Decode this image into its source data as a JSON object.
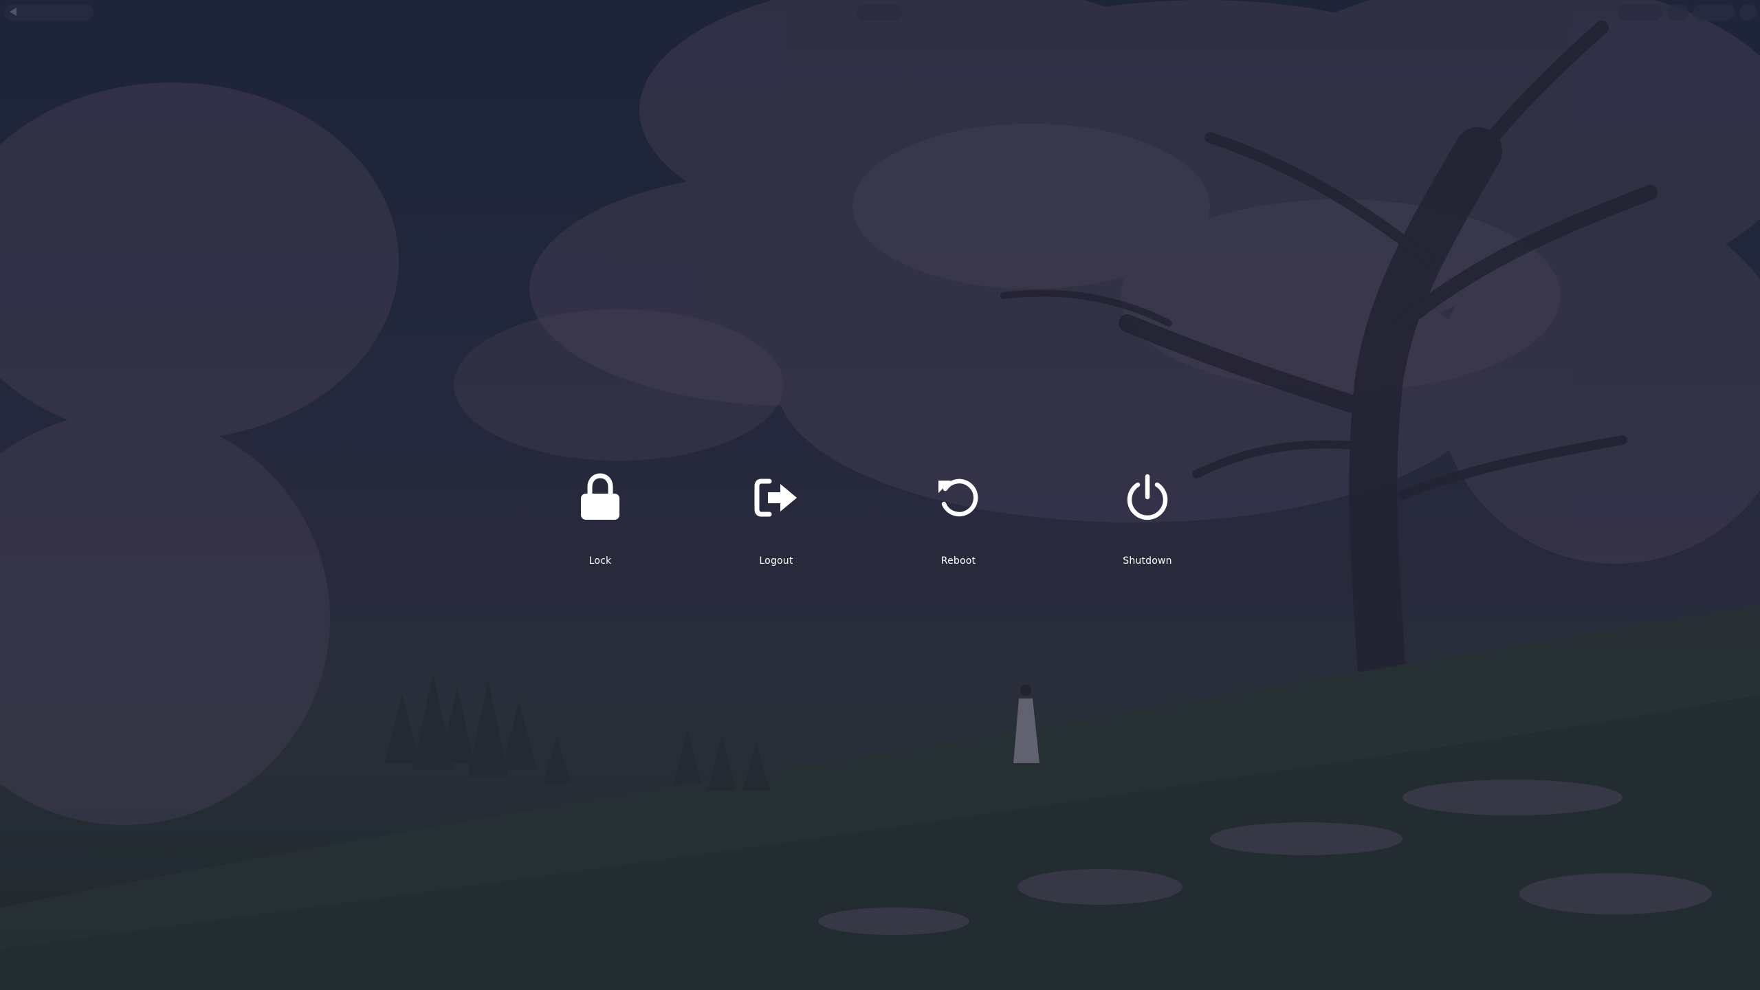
{
  "power_menu": {
    "items": [
      {
        "label": "Lock",
        "icon": "lock-icon"
      },
      {
        "label": "Logout",
        "icon": "logout-icon"
      },
      {
        "label": "Reboot",
        "icon": "reboot-icon"
      },
      {
        "label": "Shutdown",
        "icon": "power-icon"
      }
    ]
  },
  "colors": {
    "icon": "#ffffff",
    "label": "#ffffff",
    "overlay": "#1e2034"
  }
}
